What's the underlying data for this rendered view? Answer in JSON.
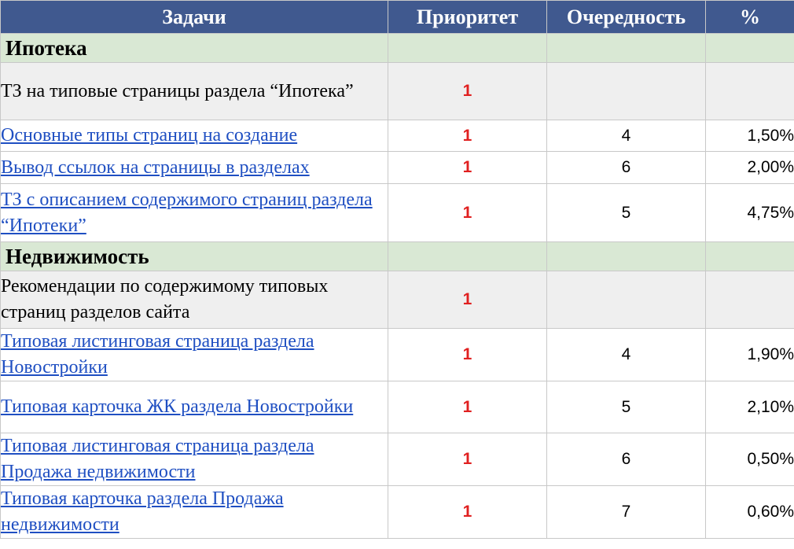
{
  "columns": {
    "task": "Задачи",
    "priority": "Приоритет",
    "order": "Очередность",
    "percent": "%"
  },
  "sections": [
    {
      "title": "Ипотека",
      "rows": [
        {
          "task": "ТЗ на типовые страницы раздела “Ипотека”",
          "link": false,
          "priority": "1",
          "order": "",
          "percent": ""
        },
        {
          "task": "Основные типы страниц на создание",
          "link": true,
          "priority": "1",
          "order": "4",
          "percent": "1,50%"
        },
        {
          "task": "Вывод ссылок на страницы в разделах",
          "link": true,
          "priority": "1",
          "order": "6",
          "percent": "2,00%"
        },
        {
          "task": "ТЗ с описанием содержимого страниц раздела “Ипотеки”",
          "link": true,
          "priority": "1",
          "order": "5",
          "percent": "4,75%"
        }
      ]
    },
    {
      "title": "Недвижимость",
      "rows": [
        {
          "task": "Рекомендации по содержимому типовых страниц разделов сайта",
          "link": false,
          "priority": "1",
          "order": "",
          "percent": ""
        },
        {
          "task": "Типовая листинговая страница раздела Новостройки",
          "link": true,
          "priority": "1",
          "order": "4",
          "percent": "1,90%"
        },
        {
          "task": "Типовая карточка ЖК раздела Новостройки",
          "link": true,
          "priority": "1",
          "order": "5",
          "percent": "2,10%"
        },
        {
          "task": "Типовая листинговая страница раздела Продажа недвижимости",
          "link": true,
          "priority": "1",
          "order": "6",
          "percent": "0,50%"
        },
        {
          "task": "Типовая карточка раздела Продажа недвижимости",
          "link": true,
          "priority": "1",
          "order": "7",
          "percent": "0,60%"
        }
      ]
    }
  ],
  "colors": {
    "header_bg": "#40598f",
    "section_bg": "#d9e8d4",
    "parent_bg": "#efefef",
    "link": "#1f4fc2",
    "priority": "#e02020"
  }
}
